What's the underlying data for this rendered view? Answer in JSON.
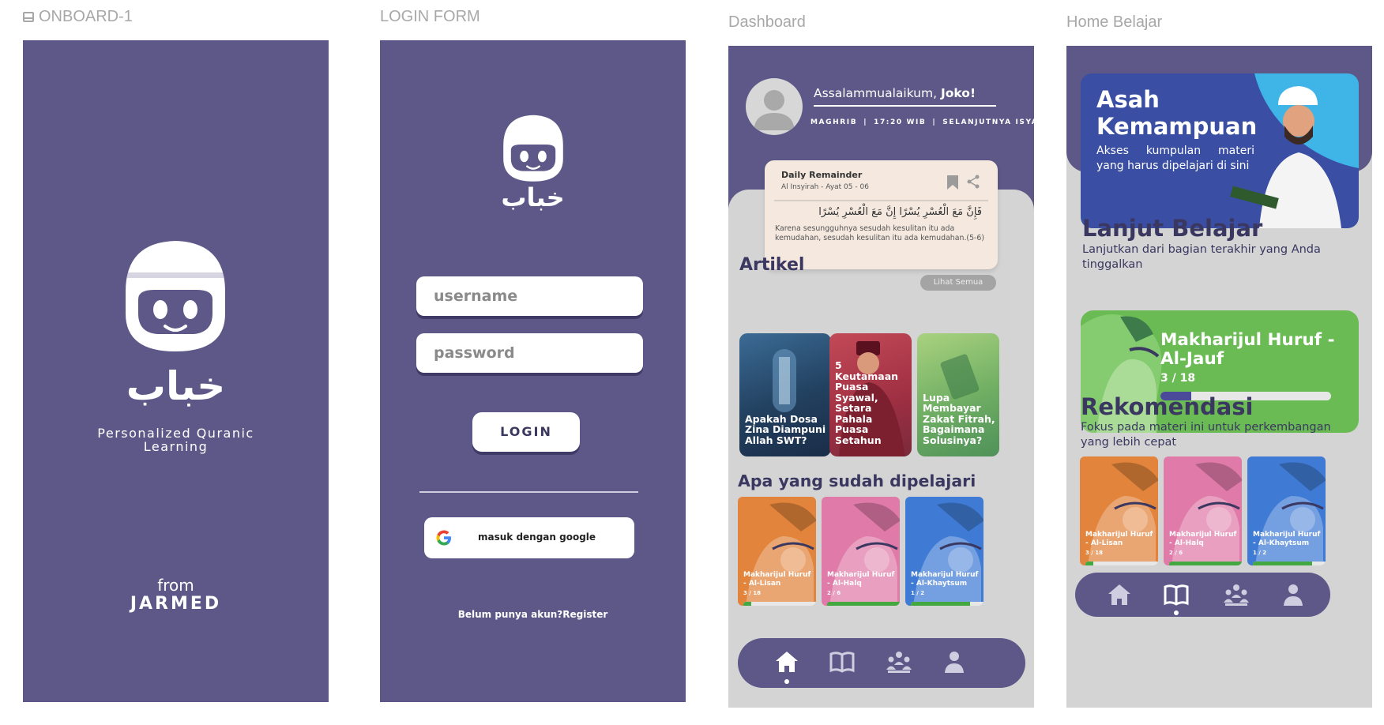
{
  "frames": {
    "onboard_label": "ONBOARD-1",
    "login_label": "LOGIN FORM",
    "dashboard_label": "Dashboard",
    "home_label": "Home Belajar"
  },
  "onboard": {
    "logo_arabic": "خباب",
    "tagline_1": "Personalized Quranic",
    "tagline_2": "Learning",
    "from": "from",
    "brand": "JARMED"
  },
  "login": {
    "logo_arabic": "خباب",
    "username_placeholder": "username",
    "password_placeholder": "password",
    "login_button": "LOGIN",
    "google_button": "masuk dengan google",
    "register_text": "Belum punya akun?Register"
  },
  "dashboard": {
    "greeting_prefix": "Assalammualaikum,",
    "greeting_name": "Joko!",
    "prayer_name": "MAGHRIB",
    "prayer_time": "17:20 WIB",
    "prayer_next": "SELANJUTNYA ISYA",
    "reminder": {
      "title": "Daily Remainder",
      "source": "Al Insyirah - Ayat 05 - 06",
      "arabic": "فَإِنَّ مَعَ الْعُسْرِ يُسْرًا إِنَّ مَعَ الْعُسْرِ يُسْرًا",
      "translation": "Karena sesungguhnya sesudah kesulitan itu ada kemudahan,   sesudah kesulitan itu ada kemudahan.(5-6)"
    },
    "articles_title": "Artikel",
    "see_all": "Lihat Semua",
    "articles": [
      {
        "title": "Apakah Dosa Zina Diampuni Allah SWT?"
      },
      {
        "title": "5 Keutamaan Puasa Syawal, Setara Pahala Puasa Setahun"
      },
      {
        "title": "Lupa Membayar Zakat Fitrah, Bagaimana Solusinya?"
      }
    ],
    "learned_title": "Apa yang sudah dipelajari",
    "learned": [
      {
        "title": "Makharijul Huruf - Al-Lisan",
        "count": "3 / 18",
        "progress": 0.1,
        "color": "#e2843c"
      },
      {
        "title": "Makharijul Huruf - Al-Halq",
        "count": "2 / 6",
        "progress": 1.0,
        "color": "#e07aa8"
      },
      {
        "title": "Makharijul Huruf - Al-Khaytsum",
        "count": "1 / 2",
        "progress": 0.78,
        "color": "#3f7bd4"
      }
    ],
    "nav": [
      "home-icon",
      "book-icon",
      "group-icon",
      "user-icon"
    ]
  },
  "home": {
    "hero_title_1": "Asah",
    "hero_title_2": "Kemampuan",
    "hero_desc": "Akses kumpulan materi yang harus dipelajari di sini",
    "continue_title": "Lanjut Belajar",
    "continue_desc": "Lanjutkan dari bagian terakhir yang Anda tinggalkan",
    "continue_card": {
      "title": "Makharijul Huruf - Al-Jauf",
      "count": "3 / 18",
      "progress": 0.18
    },
    "rec_title": "Rekomendasi",
    "rec_desc": "Fokus pada materi ini untuk perkembangan yang lebih cepat",
    "recommendations": [
      {
        "title": "Makharijul Huruf - Al-Lisan",
        "count": "3 / 18",
        "progress": 0.1,
        "color": "#e2843c"
      },
      {
        "title": "Makharijul Huruf - Al-Halq",
        "count": "2 / 6",
        "progress": 1.0,
        "color": "#e07aa8"
      },
      {
        "title": "Makharijul Huruf - Al-Khaytsum",
        "count": "1 / 2",
        "progress": 0.78,
        "color": "#3f7bd4"
      }
    ]
  },
  "colors": {
    "brand": "#5d5887",
    "panel": "#d4d4d4",
    "accent_green": "#6bbb55",
    "hero_blue": "#3a4fa3"
  }
}
